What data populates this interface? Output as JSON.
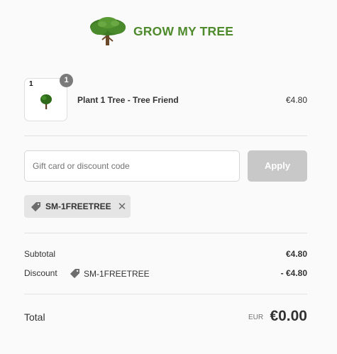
{
  "brand": {
    "name": "GROW MY TREE",
    "color": "#4f8a2c",
    "logo_icon": "tree-logo-icon"
  },
  "cart": {
    "items": [
      {
        "thumb_label": "1",
        "quantity": "1",
        "name": "Plant 1 Tree - Tree Friend",
        "price": "€4.80",
        "icon": "tree-icon"
      }
    ]
  },
  "discount": {
    "placeholder": "Gift card or discount code",
    "value": "",
    "apply_label": "Apply",
    "applied_code": "SM-1FREETREE",
    "tag_icon": "tag-icon",
    "remove_icon": "close-icon",
    "remove_glyph": "✕"
  },
  "summary": {
    "subtotal_label": "Subtotal",
    "subtotal_value": "€4.80",
    "discount_label": "Discount",
    "discount_code": "SM-1FREETREE",
    "discount_value": "- €4.80",
    "total_label": "Total",
    "currency": "EUR",
    "total_value": "€0.00"
  }
}
